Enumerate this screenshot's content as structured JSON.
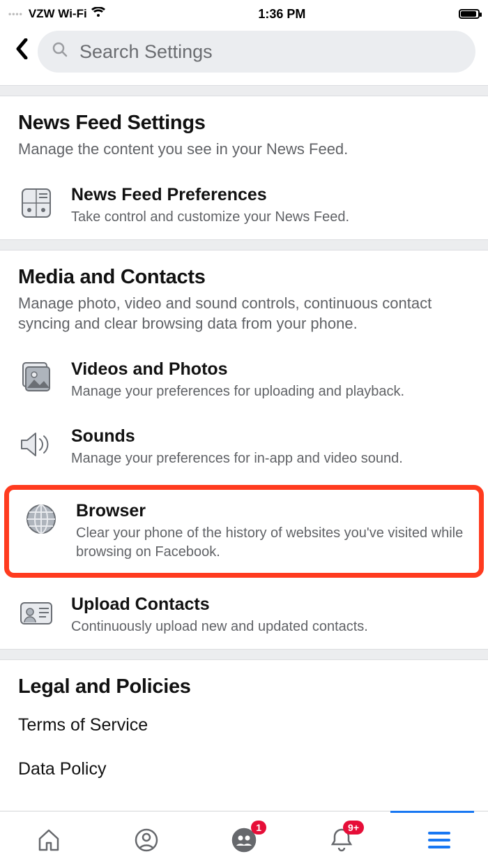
{
  "status": {
    "carrier": "VZW Wi-Fi",
    "time": "1:36 PM"
  },
  "search": {
    "placeholder": "Search Settings"
  },
  "sections": {
    "newsfeed": {
      "title": "News Feed Settings",
      "subtitle": "Manage the content you see in your News Feed.",
      "items": [
        {
          "title": "News Feed Preferences",
          "subtitle": "Take control and customize your News Feed."
        }
      ]
    },
    "media": {
      "title": "Media and Contacts",
      "subtitle": "Manage photo, video and sound controls, continuous contact syncing and clear browsing data from your phone.",
      "items": [
        {
          "title": "Videos and Photos",
          "subtitle": "Manage your preferences for uploading and playback."
        },
        {
          "title": "Sounds",
          "subtitle": "Manage your preferences for in-app and video sound."
        },
        {
          "title": "Browser",
          "subtitle": "Clear your phone of the history of websites you've visited while browsing on Facebook."
        },
        {
          "title": "Upload Contacts",
          "subtitle": "Continuously upload new and updated contacts."
        }
      ]
    },
    "legal": {
      "title": "Legal and Policies",
      "items": [
        {
          "title": "Terms of Service"
        },
        {
          "title": "Data Policy"
        }
      ]
    }
  },
  "nav": {
    "groups_badge": "1",
    "notifications_badge": "9+"
  }
}
